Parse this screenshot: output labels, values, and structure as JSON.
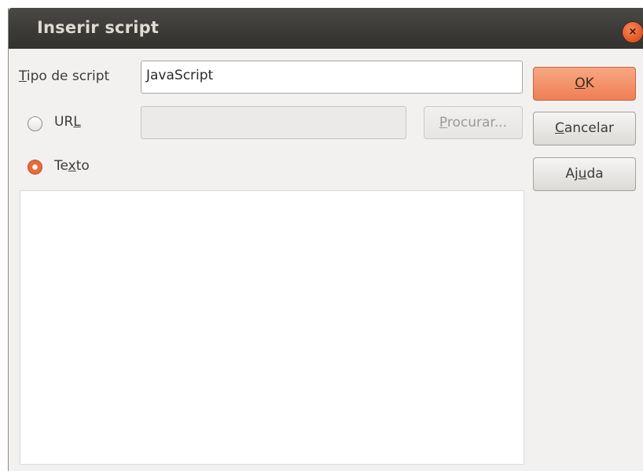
{
  "dialog": {
    "title": "Inserir script",
    "close_icon": "×"
  },
  "script_type": {
    "label_underlined": "T",
    "label_rest": "ipo de script",
    "value": "JavaScript"
  },
  "url_option": {
    "label_prefix": "UR",
    "label_underlined": "L",
    "selected": false,
    "value": ""
  },
  "browse_button": {
    "label_underlined": "P",
    "label_rest": "rocurar...",
    "enabled": false
  },
  "text_option": {
    "label_prefix": "Te",
    "label_underlined": "x",
    "label_suffix": "to",
    "selected": true
  },
  "buttons": {
    "ok": {
      "underlined": "O",
      "rest": "K"
    },
    "cancel": {
      "underlined": "C",
      "rest": "ancelar"
    },
    "help": {
      "prefix": "Aj",
      "underlined": "u",
      "suffix": "da"
    }
  },
  "script_text": "",
  "colors": {
    "accent": "#ef7f55",
    "titlebar": "#3a3935",
    "dialog_bg": "#f2f1f0"
  }
}
